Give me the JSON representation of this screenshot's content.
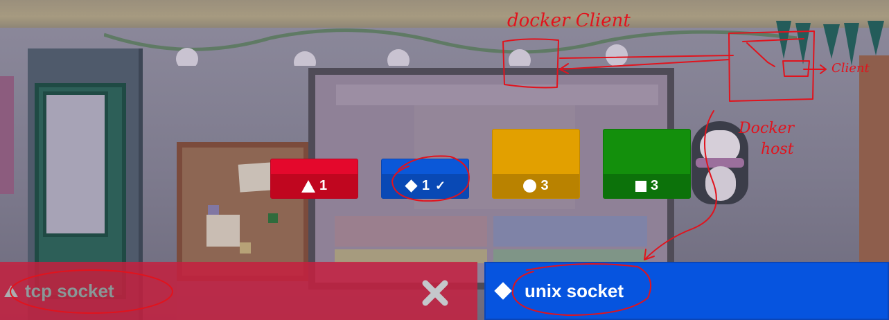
{
  "tiles": [
    {
      "shape": "triangle-icon",
      "count": "1",
      "color": "#e4082c",
      "correct": false
    },
    {
      "shape": "diamond-icon",
      "count": "1",
      "color": "#0b58d8",
      "correct": true
    },
    {
      "shape": "circle-icon",
      "count": "3",
      "color": "#e2a000",
      "correct": false
    },
    {
      "shape": "square-icon",
      "count": "3",
      "color": "#138f0c",
      "correct": false
    }
  ],
  "answers": {
    "wrong": {
      "label": "tcp socket",
      "shape": "triangle-icon",
      "color": "#c5203f"
    },
    "right": {
      "label": "unix socket",
      "shape": "diamond-icon",
      "color": "#0654df"
    }
  },
  "annotations": {
    "docker_client": "docker Client",
    "client": "Client",
    "docker_host_line1": "Docker",
    "docker_host_line2": "host",
    "ink_color": "#e1131d"
  }
}
